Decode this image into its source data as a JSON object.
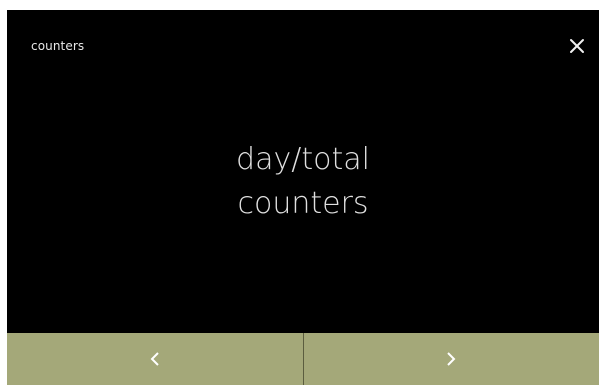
{
  "header": {
    "title": "counters",
    "close_icon": "close-icon"
  },
  "main": {
    "label_line1": "day/total",
    "label_line2": "counters"
  },
  "footer": {
    "prev_icon": "chevron-left-icon",
    "next_icon": "chevron-right-icon"
  },
  "colors": {
    "screen_background": "#000000",
    "footer_background": "#a4a879",
    "text": "#e0e0e0"
  }
}
